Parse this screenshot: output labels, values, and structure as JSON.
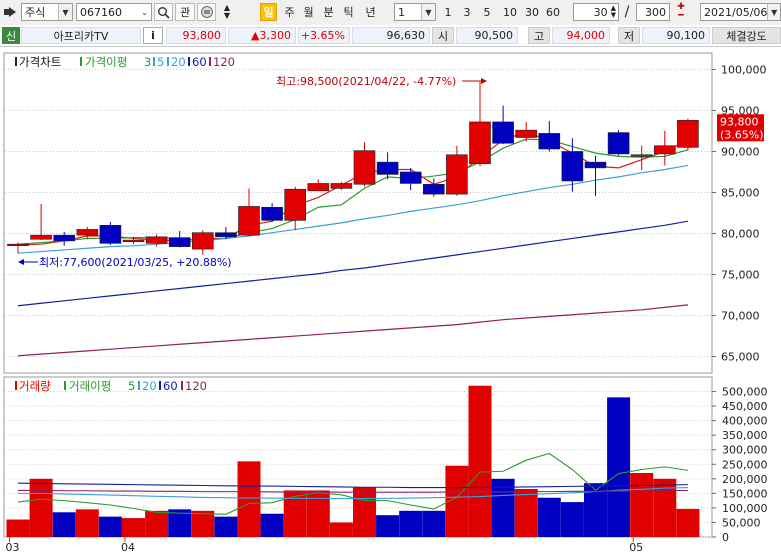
{
  "toolbar": {
    "market_select": "주식",
    "code_input": "067160",
    "kwan_label": "관",
    "period_hl": "일",
    "periods": [
      "주",
      "월",
      "분",
      "틱",
      "년"
    ],
    "interval_select": "1",
    "intervals": [
      "1",
      "3",
      "5",
      "10",
      "30",
      "60"
    ],
    "view_count": "30",
    "total_count": "300",
    "date_select": "2021/05/06"
  },
  "infobar": {
    "sin_label": "신",
    "stock_name": "아프리카TV",
    "info_label": "i",
    "price": "93,800",
    "change": "▲3,300",
    "change_pct": "+3.65%",
    "volume": "96,630",
    "open_label": "시",
    "open": "90,500",
    "high_label": "고",
    "high": "94,000",
    "low_label": "저",
    "low": "90,100",
    "strength_label": "체결강도"
  },
  "price_legend": {
    "price_chart": "가격차트",
    "ma_title": "가격이평",
    "ma": [
      "3",
      "5",
      "20",
      "60",
      "120"
    ]
  },
  "volume_legend": {
    "volume": "거래량",
    "vma_title": "거래이평",
    "vma": [
      "5",
      "20",
      "60",
      "120"
    ]
  },
  "annotations": {
    "high": "최고:98,500(2021/04/22, -4.77%)",
    "low": "최저:77,600(2021/03/25, +20.88%)",
    "current_price": "93,800",
    "current_pct": "(3.65%)"
  },
  "colors": {
    "up": "#e00000",
    "down": "#0000c0",
    "ma3": "#d02020",
    "ma5": "#2c9a2c",
    "ma20": "#3aa0d8",
    "ma60": "#1020a0",
    "ma120": "#902060"
  },
  "chart_data": {
    "type": "candlestick",
    "price_axis": {
      "ylim": [
        63000,
        102000
      ],
      "ticks": [
        "100,000",
        "95,000",
        "90,000",
        "85,000",
        "80,000",
        "75,000",
        "70,000",
        "65,000"
      ]
    },
    "volume_axis": {
      "ylim": [
        0,
        550000
      ],
      "ticks": [
        "500,000",
        "450,000",
        "400,000",
        "350,000",
        "300,000",
        "250,000",
        "200,000",
        "150,000",
        "100,000",
        "50,000",
        "0"
      ]
    },
    "x_labels": [
      {
        "index": 0,
        "label": "03"
      },
      {
        "index": 5,
        "label": "04"
      },
      {
        "index": 27,
        "label": "05"
      }
    ],
    "candles": [
      {
        "o": 78700,
        "h": 78900,
        "l": 77600,
        "c": 78700,
        "v": 60000
      },
      {
        "o": 79300,
        "h": 83600,
        "l": 79200,
        "c": 79800,
        "v": 200000
      },
      {
        "o": 79800,
        "h": 80200,
        "l": 78500,
        "c": 79100,
        "v": 85000
      },
      {
        "o": 79800,
        "h": 80800,
        "l": 79300,
        "c": 80500,
        "v": 95000
      },
      {
        "o": 81000,
        "h": 81400,
        "l": 78600,
        "c": 78800,
        "v": 70000
      },
      {
        "o": 79000,
        "h": 79600,
        "l": 78700,
        "c": 79200,
        "v": 65000
      },
      {
        "o": 78800,
        "h": 79900,
        "l": 78400,
        "c": 79600,
        "v": 90000
      },
      {
        "o": 79500,
        "h": 80300,
        "l": 78300,
        "c": 78400,
        "v": 95000
      },
      {
        "o": 78100,
        "h": 80400,
        "l": 77400,
        "c": 80100,
        "v": 90000
      },
      {
        "o": 80100,
        "h": 80800,
        "l": 79300,
        "c": 79600,
        "v": 70000
      },
      {
        "o": 79800,
        "h": 85500,
        "l": 79700,
        "c": 83300,
        "v": 260000
      },
      {
        "o": 83200,
        "h": 83700,
        "l": 81400,
        "c": 81600,
        "v": 80000
      },
      {
        "o": 81600,
        "h": 85700,
        "l": 80400,
        "c": 85400,
        "v": 160000
      },
      {
        "o": 85200,
        "h": 86600,
        "l": 85200,
        "c": 86100,
        "v": 160000
      },
      {
        "o": 85500,
        "h": 86300,
        "l": 85300,
        "c": 86100,
        "v": 50000
      },
      {
        "o": 86000,
        "h": 91100,
        "l": 85700,
        "c": 90100,
        "v": 170000
      },
      {
        "o": 88700,
        "h": 89900,
        "l": 86600,
        "c": 87200,
        "v": 75000
      },
      {
        "o": 87500,
        "h": 88000,
        "l": 85300,
        "c": 86100,
        "v": 90000
      },
      {
        "o": 86000,
        "h": 86700,
        "l": 84500,
        "c": 84800,
        "v": 90000
      },
      {
        "o": 84800,
        "h": 90700,
        "l": 84600,
        "c": 89600,
        "v": 245000
      },
      {
        "o": 88500,
        "h": 98500,
        "l": 88200,
        "c": 93600,
        "v": 520000
      },
      {
        "o": 93600,
        "h": 95600,
        "l": 90900,
        "c": 91000,
        "v": 200000
      },
      {
        "o": 91700,
        "h": 93600,
        "l": 91200,
        "c": 92600,
        "v": 165000
      },
      {
        "o": 92200,
        "h": 93700,
        "l": 90000,
        "c": 90300,
        "v": 135000
      },
      {
        "o": 90000,
        "h": 91600,
        "l": 85100,
        "c": 86400,
        "v": 120000
      },
      {
        "o": 88700,
        "h": 89500,
        "l": 84600,
        "c": 88000,
        "v": 185000
      },
      {
        "o": 92300,
        "h": 92600,
        "l": 89500,
        "c": 89700,
        "v": 480000
      },
      {
        "o": 89400,
        "h": 90700,
        "l": 87700,
        "c": 89600,
        "v": 220000
      },
      {
        "o": 89700,
        "h": 92500,
        "l": 88300,
        "c": 90700,
        "v": 200000
      },
      {
        "o": 90500,
        "h": 94000,
        "l": 90100,
        "c": 93800,
        "v": 96630
      }
    ],
    "ma_series": {
      "ma3": [
        78600,
        78700,
        79100,
        79700,
        79700,
        79400,
        79200,
        79100,
        79400,
        79400,
        81000,
        81500,
        83400,
        84400,
        85900,
        87400,
        87800,
        87800,
        86000,
        86900,
        89300,
        91400,
        92400,
        91300,
        89800,
        88200,
        88000,
        89000,
        90000,
        91400
      ],
      "ma5": [
        78700,
        78900,
        79100,
        79400,
        79400,
        79500,
        79500,
        79300,
        79200,
        79400,
        80100,
        80600,
        81700,
        83200,
        83500,
        85500,
        86900,
        86700,
        87000,
        87400,
        88700,
        90400,
        91500,
        91400,
        90600,
        89800,
        89400,
        89300,
        89400,
        90200
      ],
      "ma20": [
        77600,
        77800,
        78000,
        78200,
        78400,
        78500,
        78700,
        78900,
        79100,
        79400,
        79700,
        80100,
        80500,
        80900,
        81300,
        81800,
        82200,
        82700,
        83100,
        83500,
        84000,
        84600,
        85100,
        85600,
        86000,
        86500,
        86900,
        87400,
        87800,
        88300
      ],
      "ma60": [
        71200,
        71500,
        71800,
        72100,
        72400,
        72700,
        73000,
        73300,
        73600,
        73900,
        74200,
        74500,
        74800,
        75100,
        75500,
        75800,
        76200,
        76600,
        77000,
        77400,
        77800,
        78200,
        78600,
        79000,
        79400,
        79800,
        80200,
        80600,
        81000,
        81500
      ],
      "ma120": [
        65100,
        65300,
        65500,
        65700,
        65900,
        66100,
        66300,
        66500,
        66700,
        66900,
        67100,
        67300,
        67500,
        67700,
        67900,
        68100,
        68300,
        68500,
        68700,
        68900,
        69200,
        69500,
        69700,
        69900,
        70100,
        70300,
        70500,
        70700,
        71000,
        71300
      ]
    },
    "vma_series": {
      "vma5": [
        120000,
        130000,
        125000,
        118000,
        110000,
        98000,
        85000,
        82000,
        80000,
        78000,
        115000,
        118000,
        140000,
        152000,
        145000,
        125000,
        125000,
        110000,
        96000,
        137000,
        223000,
        226000,
        264000,
        287000,
        232000,
        161000,
        218000,
        232000,
        241000,
        229000
      ],
      "vma20": [
        150000,
        150000,
        148000,
        146000,
        144000,
        142000,
        140000,
        138000,
        136000,
        135000,
        134000,
        134000,
        133000,
        133000,
        132000,
        132000,
        133000,
        134000,
        135000,
        137000,
        139000,
        143000,
        146000,
        149000,
        152000,
        156000,
        161000,
        164000,
        168000,
        170000
      ],
      "vma60": [
        185000,
        184000,
        183000,
        182000,
        181000,
        180000,
        179000,
        178000,
        177000,
        176000,
        175000,
        175000,
        174000,
        173000,
        172000,
        171000,
        171000,
        170000,
        170000,
        170000,
        171000,
        171000,
        172000,
        173000,
        174000,
        175000,
        176000,
        177000,
        178000,
        180000
      ],
      "vma120": [
        160000,
        160000,
        159000,
        159000,
        158000,
        158000,
        157000,
        157000,
        156000,
        156000,
        156000,
        155000,
        155000,
        155000,
        154000,
        154000,
        154000,
        154000,
        154000,
        155000,
        155000,
        155000,
        156000,
        156000,
        157000,
        157000,
        158000,
        158000,
        159000,
        160000
      ]
    }
  }
}
